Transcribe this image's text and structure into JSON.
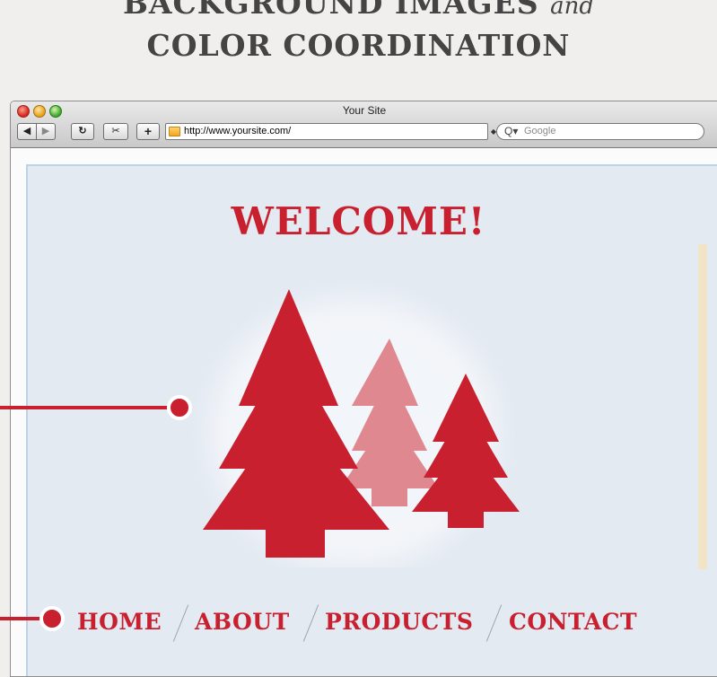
{
  "poster": {
    "heading_line1_main": "BACKGROUND IMAGES",
    "heading_line1_italic": "and",
    "heading_line2": "COLOR COORDINATION"
  },
  "browser": {
    "window_title": "Your Site",
    "url": "http://www.yoursite.com/",
    "search_placeholder": "Google",
    "search_icon_glyph": "Q▾"
  },
  "page": {
    "welcome": "WELCOME!",
    "nav": [
      "HOME",
      "ABOUT",
      "PRODUCTS",
      "CONTACT"
    ]
  },
  "colors": {
    "accent": "#c8202f",
    "tree_faded": "#df8890",
    "page_background": "#e4eaf2",
    "heading_text": "#444444"
  },
  "icons": [
    "back-arrow-icon",
    "forward-arrow-icon",
    "reload-icon",
    "snip-icon",
    "add-tab-icon",
    "folder-icon",
    "search-icon",
    "tree-icon"
  ]
}
